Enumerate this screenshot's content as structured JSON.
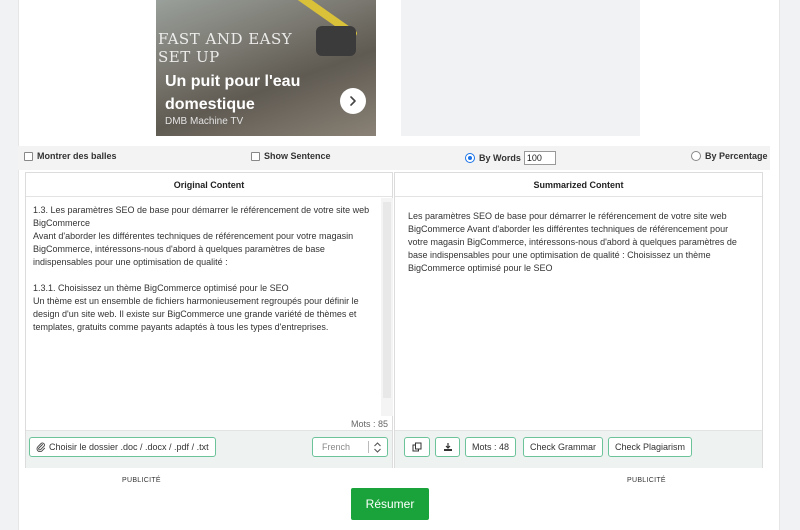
{
  "ad": {
    "overlay_text": "FAST AND EASY SET UP",
    "headline": "Un puit pour l'eau domestique",
    "source": "DMB Machine TV",
    "next_icon": "chevron-right-icon"
  },
  "options": {
    "show_balls_label": "Montrer des balles",
    "show_sentence_label": "Show Sentence",
    "by_words_label": "By Words",
    "by_words_value": "100",
    "by_percentage_label": "By Percentage",
    "selected_mode": "by_words"
  },
  "original": {
    "title": "Original Content",
    "text": "1.3. Les paramètres SEO de base pour démarrer le référencement de votre site web BigCommerce\nAvant d'aborder les différentes techniques de référencement pour votre magasin BigCommerce, intéressons-nous d'abord à quelques paramètres de base indispensables pour une optimisation de qualité :\n\n1.3.1. Choisissez un thème BigCommerce optimisé pour le SEO\nUn thème est un ensemble de fichiers harmonieusement regroupés pour définir le design d'un site web. Il existe sur BigCommerce une grande variété de thèmes et templates, gratuits comme payants adaptés à tous les types d'entreprises.",
    "word_count": "Mots : 85",
    "upload_label": "Choisir le dossier .doc / .docx / .pdf / .txt",
    "language_value": "French"
  },
  "summary": {
    "title": "Summarized Content",
    "text": "Les paramètres SEO de base pour démarrer le référencement de votre site web BigCommerce Avant d'aborder les différentes techniques de référencement pour votre magasin BigCommerce, intéressons-nous d'abord à quelques paramètres de base indispensables pour une optimisation de qualité : Choisissez un thème BigCommerce optimisé pour le SEO",
    "word_count": "Mots : 48",
    "check_grammar_label": "Check Grammar",
    "check_plagiarism_label": "Check Plagiarism"
  },
  "publicite_left": "PUBLICITÉ",
  "publicite_right": "PUBLICITÉ",
  "submit_label": "Résumer",
  "colors": {
    "accent_green": "#1aa33a",
    "button_border": "#6cc39a",
    "radio_blue": "#1a73e8"
  }
}
